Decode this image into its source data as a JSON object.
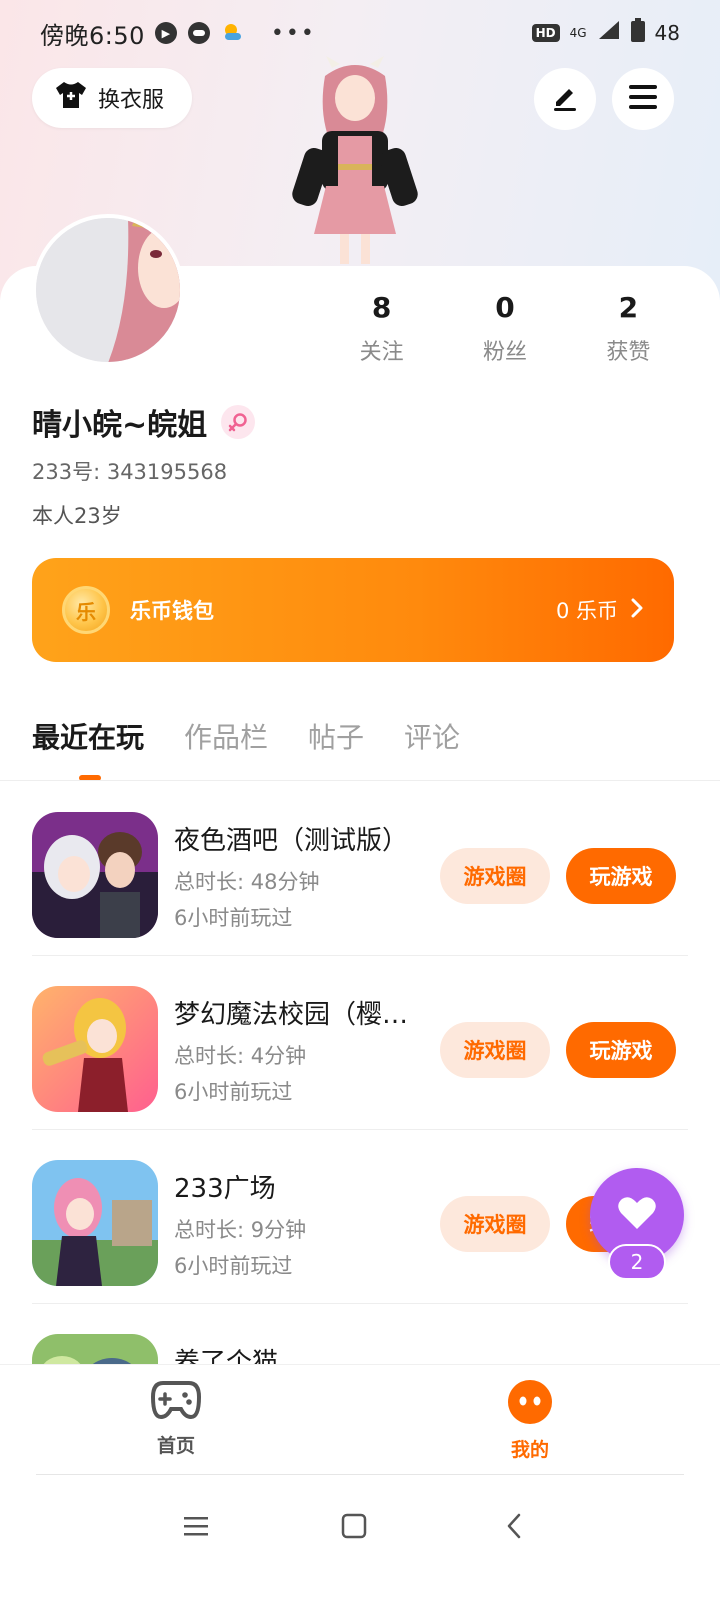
{
  "status_bar": {
    "time": "傍晚6:50",
    "network": "4G",
    "hd": "HD",
    "battery": "48"
  },
  "header": {
    "outfit_label": "换衣服"
  },
  "profile": {
    "stats": [
      {
        "value": "8",
        "label": "关注"
      },
      {
        "value": "0",
        "label": "粉丝"
      },
      {
        "value": "2",
        "label": "获赞"
      }
    ],
    "name": "晴小皖~皖姐",
    "uid": "233号: 343195568",
    "bio": "本人23岁"
  },
  "wallet": {
    "coin_glyph": "乐",
    "label": "乐币钱包",
    "balance": "0 乐币"
  },
  "tabs": [
    {
      "label": "最近在玩",
      "active": true
    },
    {
      "label": "作品栏",
      "active": false
    },
    {
      "label": "帖子",
      "active": false
    },
    {
      "label": "评论",
      "active": false
    }
  ],
  "games": [
    {
      "name": "夜色酒吧（测试版）",
      "duration": "总时长: 48分钟",
      "last_played": "6小时前玩过",
      "circle_label": "游戏圈",
      "play_label": "玩游戏"
    },
    {
      "name": "梦幻魔法校园（樱…",
      "duration": "总时长: 4分钟",
      "last_played": "6小时前玩过",
      "circle_label": "游戏圈",
      "play_label": "玩游戏"
    },
    {
      "name": "233广场",
      "duration": "总时长: 9分钟",
      "last_played": "6小时前玩过",
      "circle_label": "游戏圈",
      "play_label": "玩游戏"
    },
    {
      "name": "养了个猫"
    }
  ],
  "float_badge": {
    "count": "2"
  },
  "bottom_nav": {
    "items": [
      {
        "label": "首页",
        "active": false
      },
      {
        "label": "我的",
        "active": true
      }
    ]
  },
  "colors": {
    "accent": "#ff6a00",
    "accent_light": "#fde8dc",
    "badge_purple": "#b15cf0",
    "muted_text": "#8a8a8a"
  }
}
